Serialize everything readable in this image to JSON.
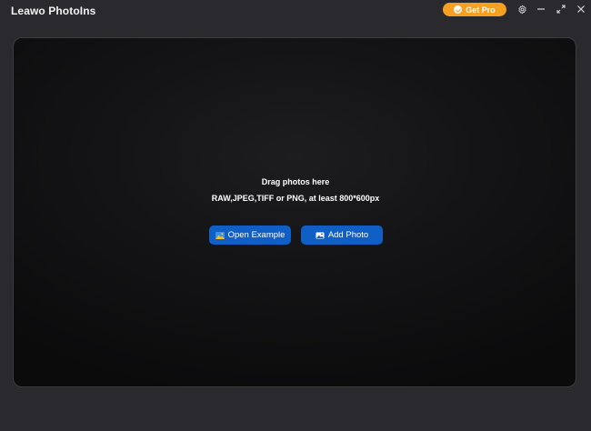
{
  "titlebar": {
    "title": "Leawo PhotoIns",
    "get_pro_label": "Get Pro",
    "icons": {
      "pro": "check-circle-icon",
      "settings": "gear-icon",
      "minimize": "minimize-icon",
      "restore": "restore-icon",
      "close": "close-icon"
    }
  },
  "dropzone": {
    "title": "Drag photos here",
    "formats": "RAW,JPEG,TIFF or PNG, at least 800*600px",
    "buttons": {
      "open_example": "Open Example",
      "add_photo": "Add Photo"
    },
    "icons": {
      "open_example": "example-image-icon",
      "add_photo": "image-icon"
    }
  },
  "colors": {
    "background": "#2a2a2e",
    "accent_orange": "#f5a020",
    "button_blue": "#0f5fc6"
  }
}
